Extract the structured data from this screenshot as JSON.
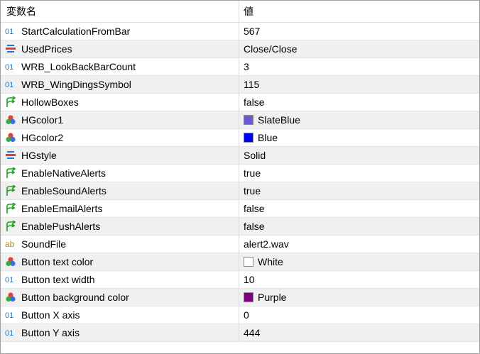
{
  "header": {
    "name_label": "変数名",
    "value_label": "値"
  },
  "rows": [
    {
      "name": "StartCalculationFromBar",
      "value": "567",
      "icon": "int-icon"
    },
    {
      "name": "UsedPrices",
      "value": "Close/Close",
      "icon": "enum-icon"
    },
    {
      "name": "WRB_LookBackBarCount",
      "value": "3",
      "icon": "int-icon"
    },
    {
      "name": "WRB_WingDingsSymbol",
      "value": "115",
      "icon": "int-icon"
    },
    {
      "name": "HollowBoxes",
      "value": "false",
      "icon": "bool-icon"
    },
    {
      "name": "HGcolor1",
      "value": "SlateBlue",
      "icon": "color-icon",
      "color": "#6A5ACD"
    },
    {
      "name": "HGcolor2",
      "value": "Blue",
      "icon": "color-icon",
      "color": "#0000FF"
    },
    {
      "name": "HGstyle",
      "value": "Solid",
      "icon": "enum-icon"
    },
    {
      "name": "EnableNativeAlerts",
      "value": "true",
      "icon": "bool-icon"
    },
    {
      "name": "EnableSoundAlerts",
      "value": "true",
      "icon": "bool-icon"
    },
    {
      "name": "EnableEmailAlerts",
      "value": "false",
      "icon": "bool-icon"
    },
    {
      "name": "EnablePushAlerts",
      "value": "false",
      "icon": "bool-icon"
    },
    {
      "name": "SoundFile",
      "value": "alert2.wav",
      "icon": "string-icon"
    },
    {
      "name": "Button text color",
      "value": "White",
      "icon": "color-icon",
      "color": "#FFFFFF"
    },
    {
      "name": "Button text width",
      "value": "10",
      "icon": "int-icon"
    },
    {
      "name": "Button background color",
      "value": "Purple",
      "icon": "color-icon",
      "color": "#800080"
    },
    {
      "name": "Button X axis",
      "value": "0",
      "icon": "int-icon"
    },
    {
      "name": "Button Y axis",
      "value": "444",
      "icon": "int-icon"
    }
  ],
  "colors": {
    "int_icon": "#1f78c8",
    "bool_icon": "#1ea01e",
    "string_icon": "#b08a2e",
    "enum_red": "#e0403a",
    "enum_blue": "#2a6fd6",
    "color_red": "#e04040",
    "color_green": "#35b035",
    "color_blue": "#3a6fe0"
  }
}
